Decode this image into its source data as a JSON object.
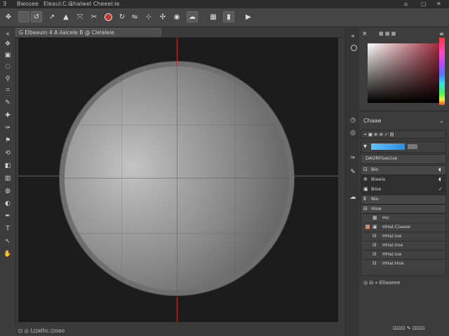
{
  "menubar": {
    "items": [
      "Ǝ",
      "Bwosee",
      "Eleaul:C.G",
      "chalwel Cheeel:le"
    ],
    "right_icons": [
      "⌂",
      "▢",
      "✕"
    ]
  },
  "options_bar": {
    "tools": [
      "move-icon",
      "rect-icon",
      "lasso-icon",
      "arrow-icon",
      "warp-icon",
      "transform-icon",
      "record-icon",
      "rotate-icon",
      "align-icon",
      "shape-icon",
      "puppet-icon",
      "light-icon",
      "cloud-icon",
      "cam-icon",
      "video-icon"
    ]
  },
  "document": {
    "tab_label": "G  Elbeauin  4  A  ilaicele  B  @  Clelaleie"
  },
  "status_bar": {
    "text": "⊡ ◎  L⊡elhc.⊡oeo"
  },
  "colors": {
    "guide": "#c0392b",
    "canvas_bg": "#1c1c1c",
    "panel_bg": "#3b3b3b",
    "sphere_rim": "#6f6f6f"
  },
  "layers_panel": {
    "title": "Chaae",
    "toolbar_label": "⌖ ▣ ⊕ ⊗ ✓ ▤",
    "gradient_label": "DAORFioeciue",
    "rows": [
      {
        "icon": "⊡",
        "label": "Bio"
      },
      {
        "icon": "⊚",
        "label": "Biaeia"
      },
      {
        "icon": "▣",
        "label": "Bioe"
      },
      {
        "icon": "E",
        "label": "Nio"
      },
      {
        "icon": "⊟",
        "label": "Hioe"
      }
    ],
    "sublayers": [
      {
        "icon": "▦",
        "label": "Hic"
      },
      {
        "icon": "▣",
        "label": "HHal:Ciaeoe"
      },
      {
        "icon": "⊟",
        "label": "HHai:ioe"
      },
      {
        "icon": "⊟",
        "label": "HHai:iioe"
      },
      {
        "icon": "⊟",
        "label": "HHai:ioe"
      },
      {
        "icon": "⊟",
        "label": "HHai:Hoe"
      }
    ],
    "footer": "◎ ⊟ ⌖  Ellaoeee",
    "bottom_status": "⊡⊡⊡ ✎ ⊡⊡⊡"
  }
}
